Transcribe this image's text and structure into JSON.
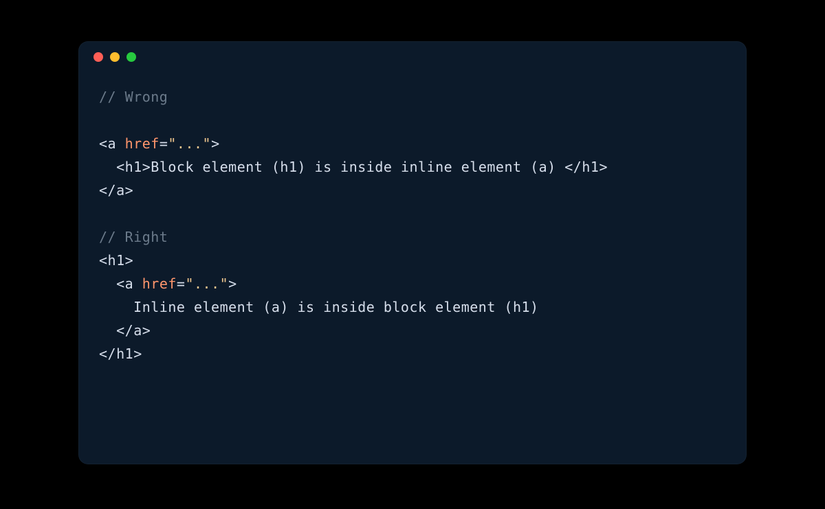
{
  "colors": {
    "close": "#ff5f56",
    "minimize": "#ffbd2e",
    "zoom": "#27c93f",
    "bg": "#0c1a2a"
  },
  "code": {
    "lines": [
      [
        {
          "cls": "tk-comment",
          "t": "// Wrong"
        }
      ],
      [],
      [
        {
          "cls": "tk-punct",
          "t": "<"
        },
        {
          "cls": "tk-tag",
          "t": "a"
        },
        {
          "cls": "tk-text",
          "t": " "
        },
        {
          "cls": "tk-attr",
          "t": "href"
        },
        {
          "cls": "tk-op",
          "t": "="
        },
        {
          "cls": "tk-string",
          "t": "\"...\""
        },
        {
          "cls": "tk-punct",
          "t": ">"
        }
      ],
      [
        {
          "cls": "tk-text",
          "t": "  "
        },
        {
          "cls": "tk-punct",
          "t": "<"
        },
        {
          "cls": "tk-tag",
          "t": "h1"
        },
        {
          "cls": "tk-punct",
          "t": ">"
        },
        {
          "cls": "tk-text",
          "t": "Block element (h1) is inside inline element (a) "
        },
        {
          "cls": "tk-punct",
          "t": "</"
        },
        {
          "cls": "tk-tag",
          "t": "h1"
        },
        {
          "cls": "tk-punct",
          "t": ">"
        }
      ],
      [
        {
          "cls": "tk-punct",
          "t": "</"
        },
        {
          "cls": "tk-tag",
          "t": "a"
        },
        {
          "cls": "tk-punct",
          "t": ">"
        }
      ],
      [],
      [
        {
          "cls": "tk-comment",
          "t": "// Right"
        }
      ],
      [
        {
          "cls": "tk-punct",
          "t": "<"
        },
        {
          "cls": "tk-tag",
          "t": "h1"
        },
        {
          "cls": "tk-punct",
          "t": ">"
        }
      ],
      [
        {
          "cls": "tk-text",
          "t": "  "
        },
        {
          "cls": "tk-punct",
          "t": "<"
        },
        {
          "cls": "tk-tag",
          "t": "a"
        },
        {
          "cls": "tk-text",
          "t": " "
        },
        {
          "cls": "tk-attr",
          "t": "href"
        },
        {
          "cls": "tk-op",
          "t": "="
        },
        {
          "cls": "tk-string",
          "t": "\"...\""
        },
        {
          "cls": "tk-punct",
          "t": ">"
        }
      ],
      [
        {
          "cls": "tk-text",
          "t": "    Inline element (a) is inside block element (h1)"
        }
      ],
      [
        {
          "cls": "tk-text",
          "t": "  "
        },
        {
          "cls": "tk-punct",
          "t": "</"
        },
        {
          "cls": "tk-tag",
          "t": "a"
        },
        {
          "cls": "tk-punct",
          "t": ">"
        }
      ],
      [
        {
          "cls": "tk-punct",
          "t": "</"
        },
        {
          "cls": "tk-tag",
          "t": "h1"
        },
        {
          "cls": "tk-punct",
          "t": ">"
        }
      ]
    ]
  }
}
